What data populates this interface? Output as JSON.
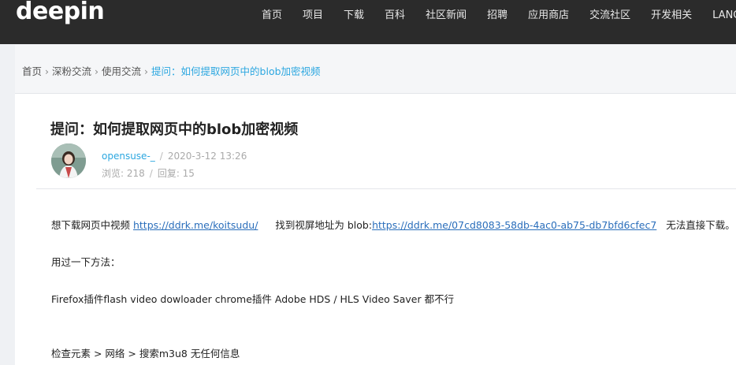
{
  "header": {
    "logo": "deepin",
    "nav": [
      "首页",
      "项目",
      "下载",
      "百科",
      "社区新闻",
      "招聘",
      "应用商店",
      "交流社区",
      "开发相关",
      "LANG"
    ]
  },
  "breadcrumb": {
    "items": [
      "首页",
      "深粉交流",
      "使用交流"
    ],
    "separator": "›",
    "current": "提问：如何提取网页中的blob加密视频"
  },
  "post": {
    "title": "提问：如何提取网页中的blob加密视频",
    "author": "opensuse-_",
    "date": "2020-3-12 13:26",
    "views": "浏览: 218",
    "replies": "回复: 15",
    "body": {
      "p1_text1": "想下载网页中视频 ",
      "p1_link1": "https://ddrk.me/koitsudu/",
      "p1_text2": "找到视屏地址为 blob:",
      "p1_link2": "https://ddrk.me/07cd8083-58db-4ac0-ab75-db7bfd6cfec7",
      "p1_text3": "无法直接下载。",
      "p2": "用过一下方法：",
      "p3": "Firefox插件flash video dowloader   chrome插件 Adobe HDS / HLS Video Saver  都不行",
      "p4": "检查元素 >  网络 > 搜索m3u8 无任何信息"
    }
  }
}
